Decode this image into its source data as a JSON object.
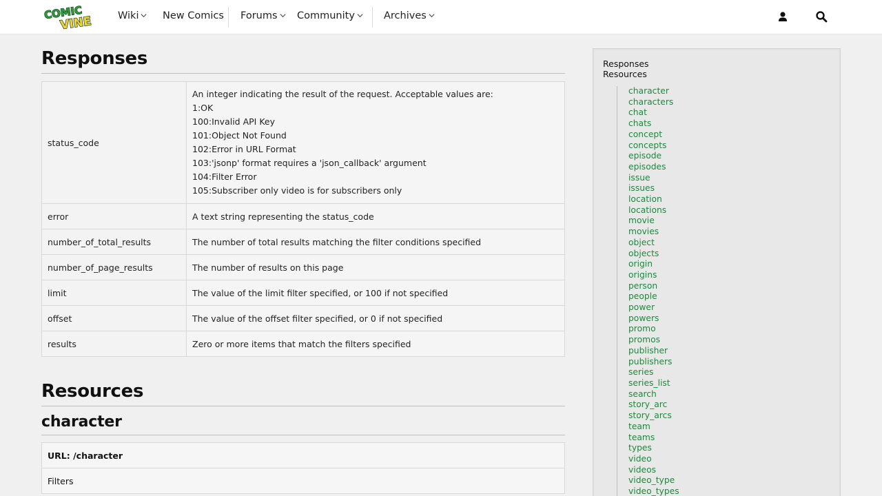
{
  "nav": {
    "logo_text": "COMIC VINE",
    "wiki": "Wiki",
    "new_comics": "New Comics",
    "forums": "Forums",
    "community": "Community",
    "archives": "Archives"
  },
  "responses": {
    "heading": "Responses",
    "status_code": {
      "key": "status_code",
      "lines": [
        "An integer indicating the result of the request. Acceptable values are:",
        "1:OK",
        "100:Invalid API Key",
        "101:Object Not Found",
        "102:Error in URL Format",
        "103:'jsonp' format requires a 'json_callback' argument",
        "104:Filter Error",
        "105:Subscriber only video is for subscribers only"
      ]
    },
    "rows": [
      {
        "key": "error",
        "value": "A text string representing the status_code"
      },
      {
        "key": "number_of_total_results",
        "value": "The number of total results matching the filter conditions specified"
      },
      {
        "key": "number_of_page_results",
        "value": "The number of results on this page"
      },
      {
        "key": "limit",
        "value": "The value of the limit filter specified, or 100 if not specified"
      },
      {
        "key": "offset",
        "value": "The value of the offset filter specified, or 0 if not specified"
      },
      {
        "key": "results",
        "value": "Zero or more items that match the filters specified"
      }
    ]
  },
  "resources": {
    "heading": "Resources",
    "character": {
      "heading": "character",
      "url": "URL: /character",
      "filters": "Filters"
    }
  },
  "sidebar": {
    "top_links": [
      "Responses",
      "Resources"
    ],
    "resources": [
      "character",
      "characters",
      "chat",
      "chats",
      "concept",
      "concepts",
      "episode",
      "episodes",
      "issue",
      "issues",
      "location",
      "locations",
      "movie",
      "movies",
      "object",
      "objects",
      "origin",
      "origins",
      "person",
      "people",
      "power",
      "powers",
      "promo",
      "promos",
      "publisher",
      "publishers",
      "series",
      "series_list",
      "search",
      "story_arc",
      "story_arcs",
      "team",
      "teams",
      "types",
      "video",
      "videos",
      "video_type",
      "video_types"
    ],
    "link_color": "#1a8a3a"
  },
  "colors": {
    "logo_green": "#2e9a3c",
    "logo_yellow": "#f2d23a"
  }
}
